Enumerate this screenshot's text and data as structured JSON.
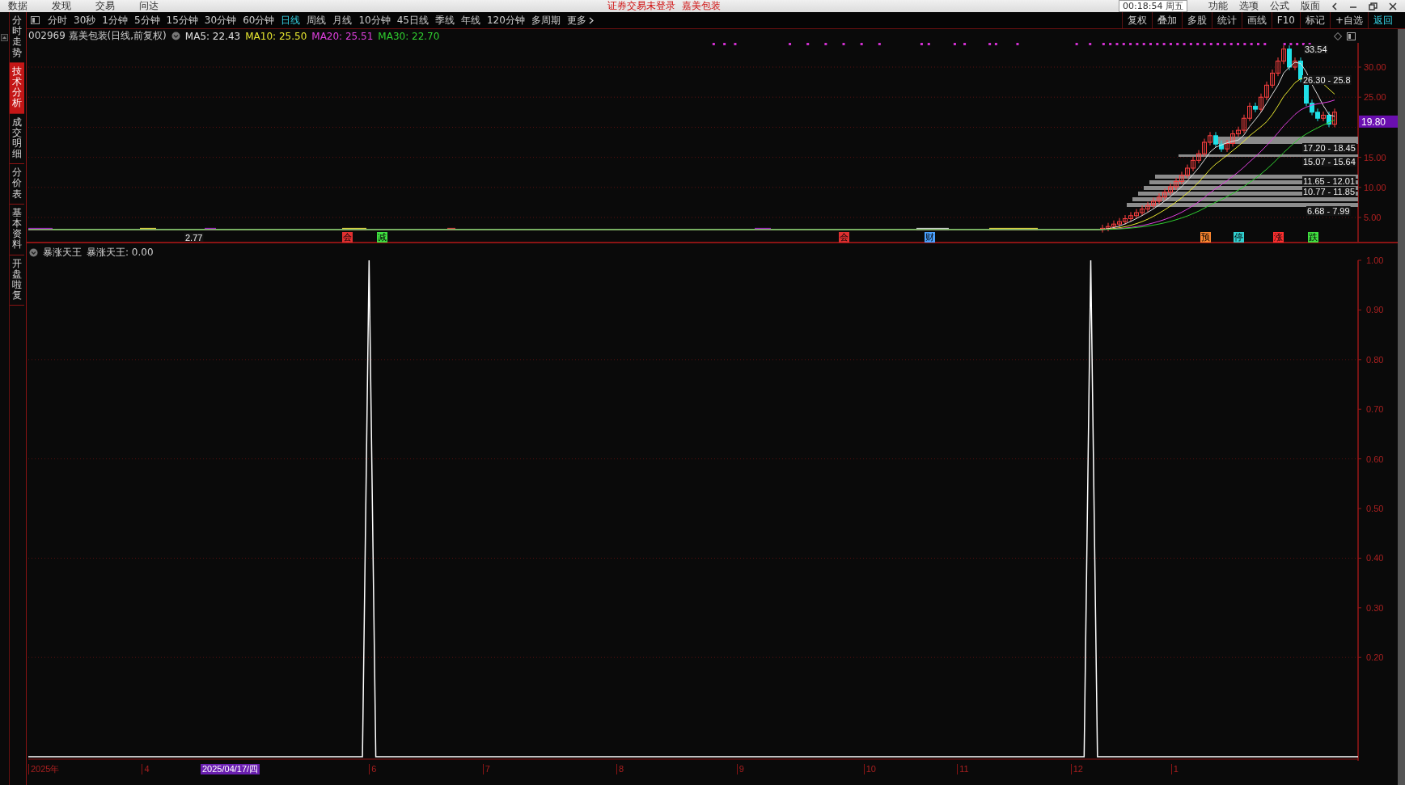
{
  "menu_bar": {
    "menus": [
      "数据",
      "发现",
      "交易",
      "问达"
    ],
    "notice": "证券交易未登录",
    "stock_name": "嘉美包装",
    "clock": "00:18:54 周五",
    "right_menus": [
      "功能",
      "选项",
      "公式",
      "版面"
    ]
  },
  "sidebar": {
    "tabs": [
      {
        "label": "分时走势",
        "selected": false
      },
      {
        "label": "技术分析",
        "selected": true
      },
      {
        "label": "成交明细",
        "selected": false
      },
      {
        "label": "分价表",
        "selected": false
      },
      {
        "label": "基本资料",
        "selected": false
      },
      {
        "label": "开盘啦复",
        "selected": false
      }
    ]
  },
  "toolbar": {
    "periods": [
      {
        "label": "分时",
        "selected": false
      },
      {
        "label": "30秒",
        "selected": false
      },
      {
        "label": "1分钟",
        "selected": false
      },
      {
        "label": "5分钟",
        "selected": false
      },
      {
        "label": "15分钟",
        "selected": false
      },
      {
        "label": "30分钟",
        "selected": false
      },
      {
        "label": "60分钟",
        "selected": false
      },
      {
        "label": "日线",
        "selected": true
      },
      {
        "label": "周线",
        "selected": false
      },
      {
        "label": "月线",
        "selected": false
      },
      {
        "label": "10分钟",
        "selected": false
      },
      {
        "label": "45日线",
        "selected": false
      },
      {
        "label": "季线",
        "selected": false
      },
      {
        "label": "年线",
        "selected": false
      },
      {
        "label": "120分钟",
        "selected": false
      },
      {
        "label": "多周期",
        "selected": false
      }
    ],
    "more": "更多",
    "actions": [
      {
        "label": "复权",
        "highlighted": false
      },
      {
        "label": "叠加",
        "highlighted": false
      },
      {
        "label": "多股",
        "highlighted": false
      },
      {
        "label": "统计",
        "highlighted": false
      },
      {
        "label": "画线",
        "highlighted": false
      },
      {
        "label": "F10",
        "highlighted": false
      },
      {
        "label": "标记",
        "highlighted": false
      },
      {
        "label": "+自选",
        "highlighted": false
      },
      {
        "label": "返回",
        "highlighted": true
      }
    ]
  },
  "price_chart": {
    "title": "002969 嘉美包装(日线,前复权)",
    "ma_values": [
      {
        "label": "MA5: 22.43",
        "color": "#e0e0e0"
      },
      {
        "label": "MA10: 25.50",
        "color": "#e8e830"
      },
      {
        "label": "MA20: 25.51",
        "color": "#e040e0"
      },
      {
        "label": "MA30: 22.70",
        "color": "#30d030"
      }
    ],
    "price_labels": [
      "30.00",
      "25.00",
      "15.00",
      "10.00",
      "5.00"
    ],
    "current_price": "19.80",
    "annotations": [
      "33.54",
      "26.30 - 25.8",
      "17.20 - 18.45",
      "15.07 - 15.64",
      "11.65 - 12.01",
      "10.77 - 11.85",
      "6.68 - 7.99",
      "2.77"
    ],
    "markers": [
      {
        "label": "会",
        "color": "#e03030"
      },
      {
        "label": "减",
        "color": "#40e040"
      },
      {
        "label": "会",
        "color": "#e03030"
      },
      {
        "label": "财",
        "color": "#4aa0ff"
      },
      {
        "label": "预",
        "color": "#ff8830"
      },
      {
        "label": "停",
        "color": "#30d0d0"
      },
      {
        "label": "涨",
        "color": "#ff3030"
      },
      {
        "label": "跌",
        "color": "#40e040"
      }
    ]
  },
  "indicator": {
    "reading": "暴涨天王: 0.00",
    "chart_data": {
      "type": "line",
      "series": [
        {
          "name": "暴涨天王",
          "color": "#ffffff",
          "values": [
            0,
            0,
            0,
            0,
            0,
            0,
            0,
            0,
            0,
            0,
            0,
            0,
            0,
            0,
            0,
            0,
            0,
            0,
            0,
            0,
            0,
            0,
            0,
            0,
            0,
            0,
            0,
            0,
            0,
            0,
            0,
            0,
            0,
            0,
            0,
            0,
            0,
            0,
            0,
            0,
            0,
            0,
            0,
            0,
            0,
            0,
            0,
            0,
            0,
            0,
            0,
            1,
            0,
            0,
            0,
            0,
            0,
            0,
            0,
            0,
            0,
            0,
            0,
            0,
            0,
            0,
            0,
            0,
            0,
            0,
            0,
            0,
            0,
            0,
            0,
            0,
            0,
            0,
            0,
            0,
            0,
            0,
            0,
            0,
            0,
            0,
            0,
            0,
            0,
            0,
            0,
            0,
            0,
            0,
            0,
            0,
            0,
            0,
            0,
            0,
            0,
            0,
            0,
            0,
            0,
            0,
            0,
            0,
            0,
            0,
            0,
            0,
            0,
            0,
            0,
            0,
            0,
            0,
            0,
            0,
            0,
            0,
            0,
            0,
            0,
            0,
            0,
            0,
            0,
            0,
            0,
            0,
            0,
            0,
            0,
            0,
            0,
            0,
            0,
            0,
            0,
            0,
            0,
            0,
            0,
            0,
            0,
            0,
            0,
            0,
            0,
            0,
            0,
            0,
            0,
            0,
            0,
            0,
            0,
            1,
            0,
            0,
            0,
            0,
            0,
            0,
            0,
            0,
            0,
            0,
            0,
            0,
            0,
            0,
            0,
            0,
            0,
            0,
            0,
            0,
            0,
            0,
            0,
            0,
            0,
            0,
            0,
            0,
            0,
            0,
            0,
            0,
            0,
            0,
            0,
            0,
            0,
            0,
            0,
            0
          ]
        }
      ],
      "ylim": [
        0,
        1
      ],
      "grid": true,
      "yticks": [
        {
          "value": 1,
          "label": "1.00"
        },
        {
          "value": 0.9,
          "label": "0.90"
        },
        {
          "value": 0.8,
          "label": "0.80"
        },
        {
          "value": 0.7,
          "label": "0.70"
        },
        {
          "value": 0.6,
          "label": "0.60"
        },
        {
          "value": 0.5,
          "label": "0.50"
        },
        {
          "value": 0.4,
          "label": "0.40"
        },
        {
          "value": 0.3,
          "label": "0.30"
        },
        {
          "value": 0.2,
          "label": "0.20"
        }
      ]
    }
  },
  "time_axis": {
    "labels": [
      "2025年",
      "4",
      "6",
      "7",
      "8",
      "9",
      "10",
      "11",
      "12",
      "1"
    ],
    "cursor_date": "2025/04/17/四"
  }
}
